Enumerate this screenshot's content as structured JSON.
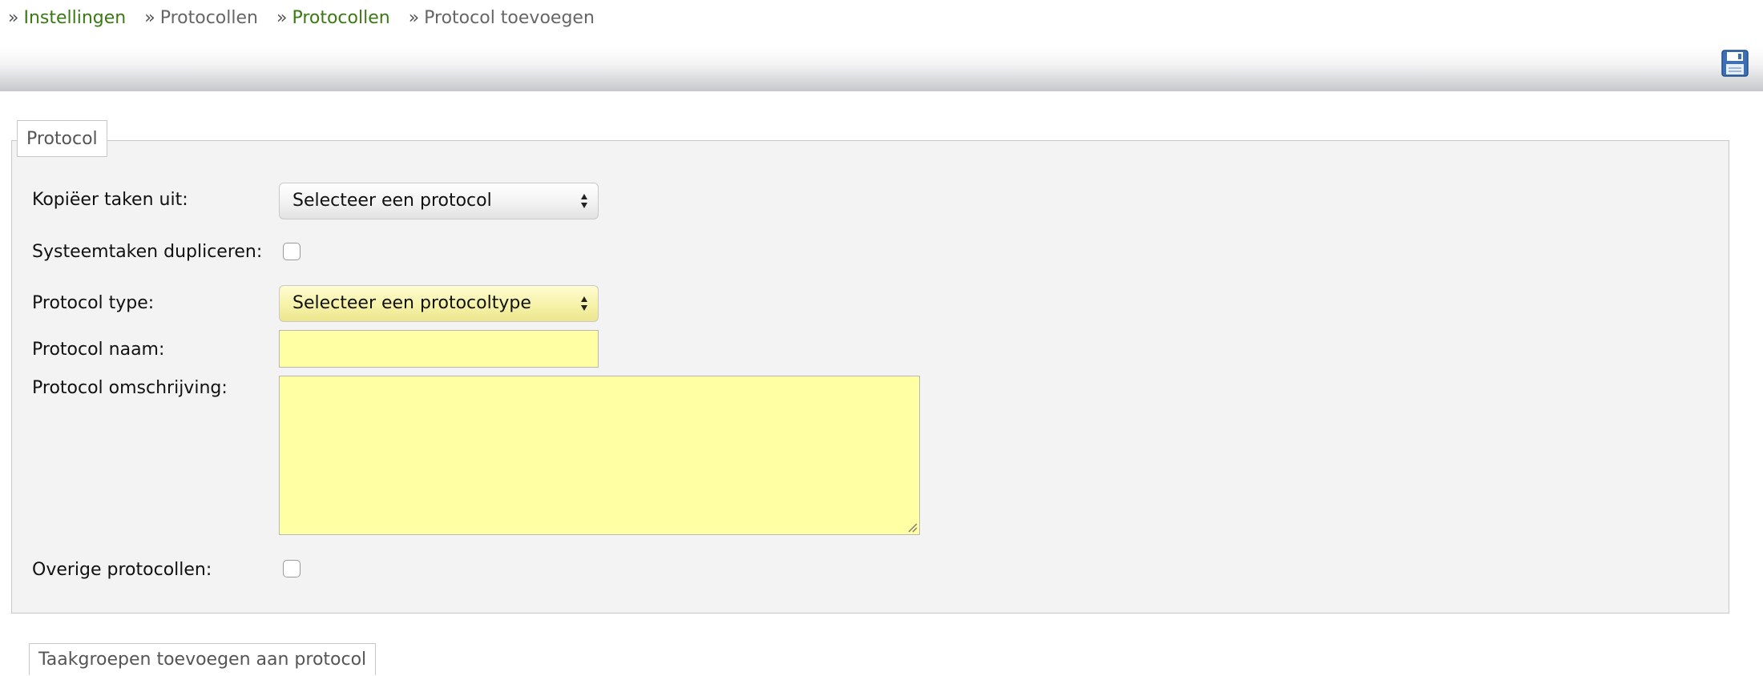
{
  "breadcrumb": {
    "separator": "»",
    "items": [
      {
        "label": "Instellingen",
        "is_link": true
      },
      {
        "label": "Protocollen",
        "is_link": false
      },
      {
        "label": "Protocollen",
        "is_link": true
      },
      {
        "label": "Protocol toevoegen",
        "is_link": false
      }
    ]
  },
  "toolbar": {
    "save_icon": "floppy-disk-icon"
  },
  "form": {
    "legend": "Protocol",
    "copy_tasks": {
      "label": "Kopiëer taken uit:",
      "selected": "Selecteer een protocol"
    },
    "duplicate_system_tasks": {
      "label": "Systeemtaken dupliceren:",
      "checked": false
    },
    "protocol_type": {
      "label": "Protocol type:",
      "selected": "Selecteer een protocoltype"
    },
    "protocol_name": {
      "label": "Protocol naam:",
      "value": ""
    },
    "protocol_description": {
      "label": "Protocol omschrijving:",
      "value": ""
    },
    "other_protocols": {
      "label": "Overige protocollen:",
      "checked": false
    }
  },
  "next_section": {
    "legend": "Taakgroepen toevoegen aan protocol"
  },
  "colors": {
    "link": "#3a7a12",
    "required_field": "#ffffa4",
    "fieldset_bg": "#f3f3f3"
  }
}
